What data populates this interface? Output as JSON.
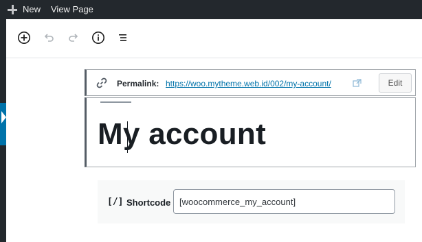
{
  "admin_bar": {
    "new_label": "New",
    "view_page_label": "View Page"
  },
  "toolbar": {
    "icons": [
      "add-block-icon",
      "undo-icon",
      "redo-icon",
      "info-icon",
      "list-view-icon"
    ]
  },
  "permalink": {
    "label": "Permalink:",
    "url": "https://woo.mytheme.web.id/002/my-account/",
    "edit_label": "Edit"
  },
  "post": {
    "title": "My account"
  },
  "shortcode_block": {
    "icon_text": "[/]",
    "label": "Shortcode",
    "value": "[woocommerce_my_account]"
  },
  "colors": {
    "admin_bar_bg": "#23282d",
    "accent": "#0073aa",
    "link": "#0073aa"
  }
}
